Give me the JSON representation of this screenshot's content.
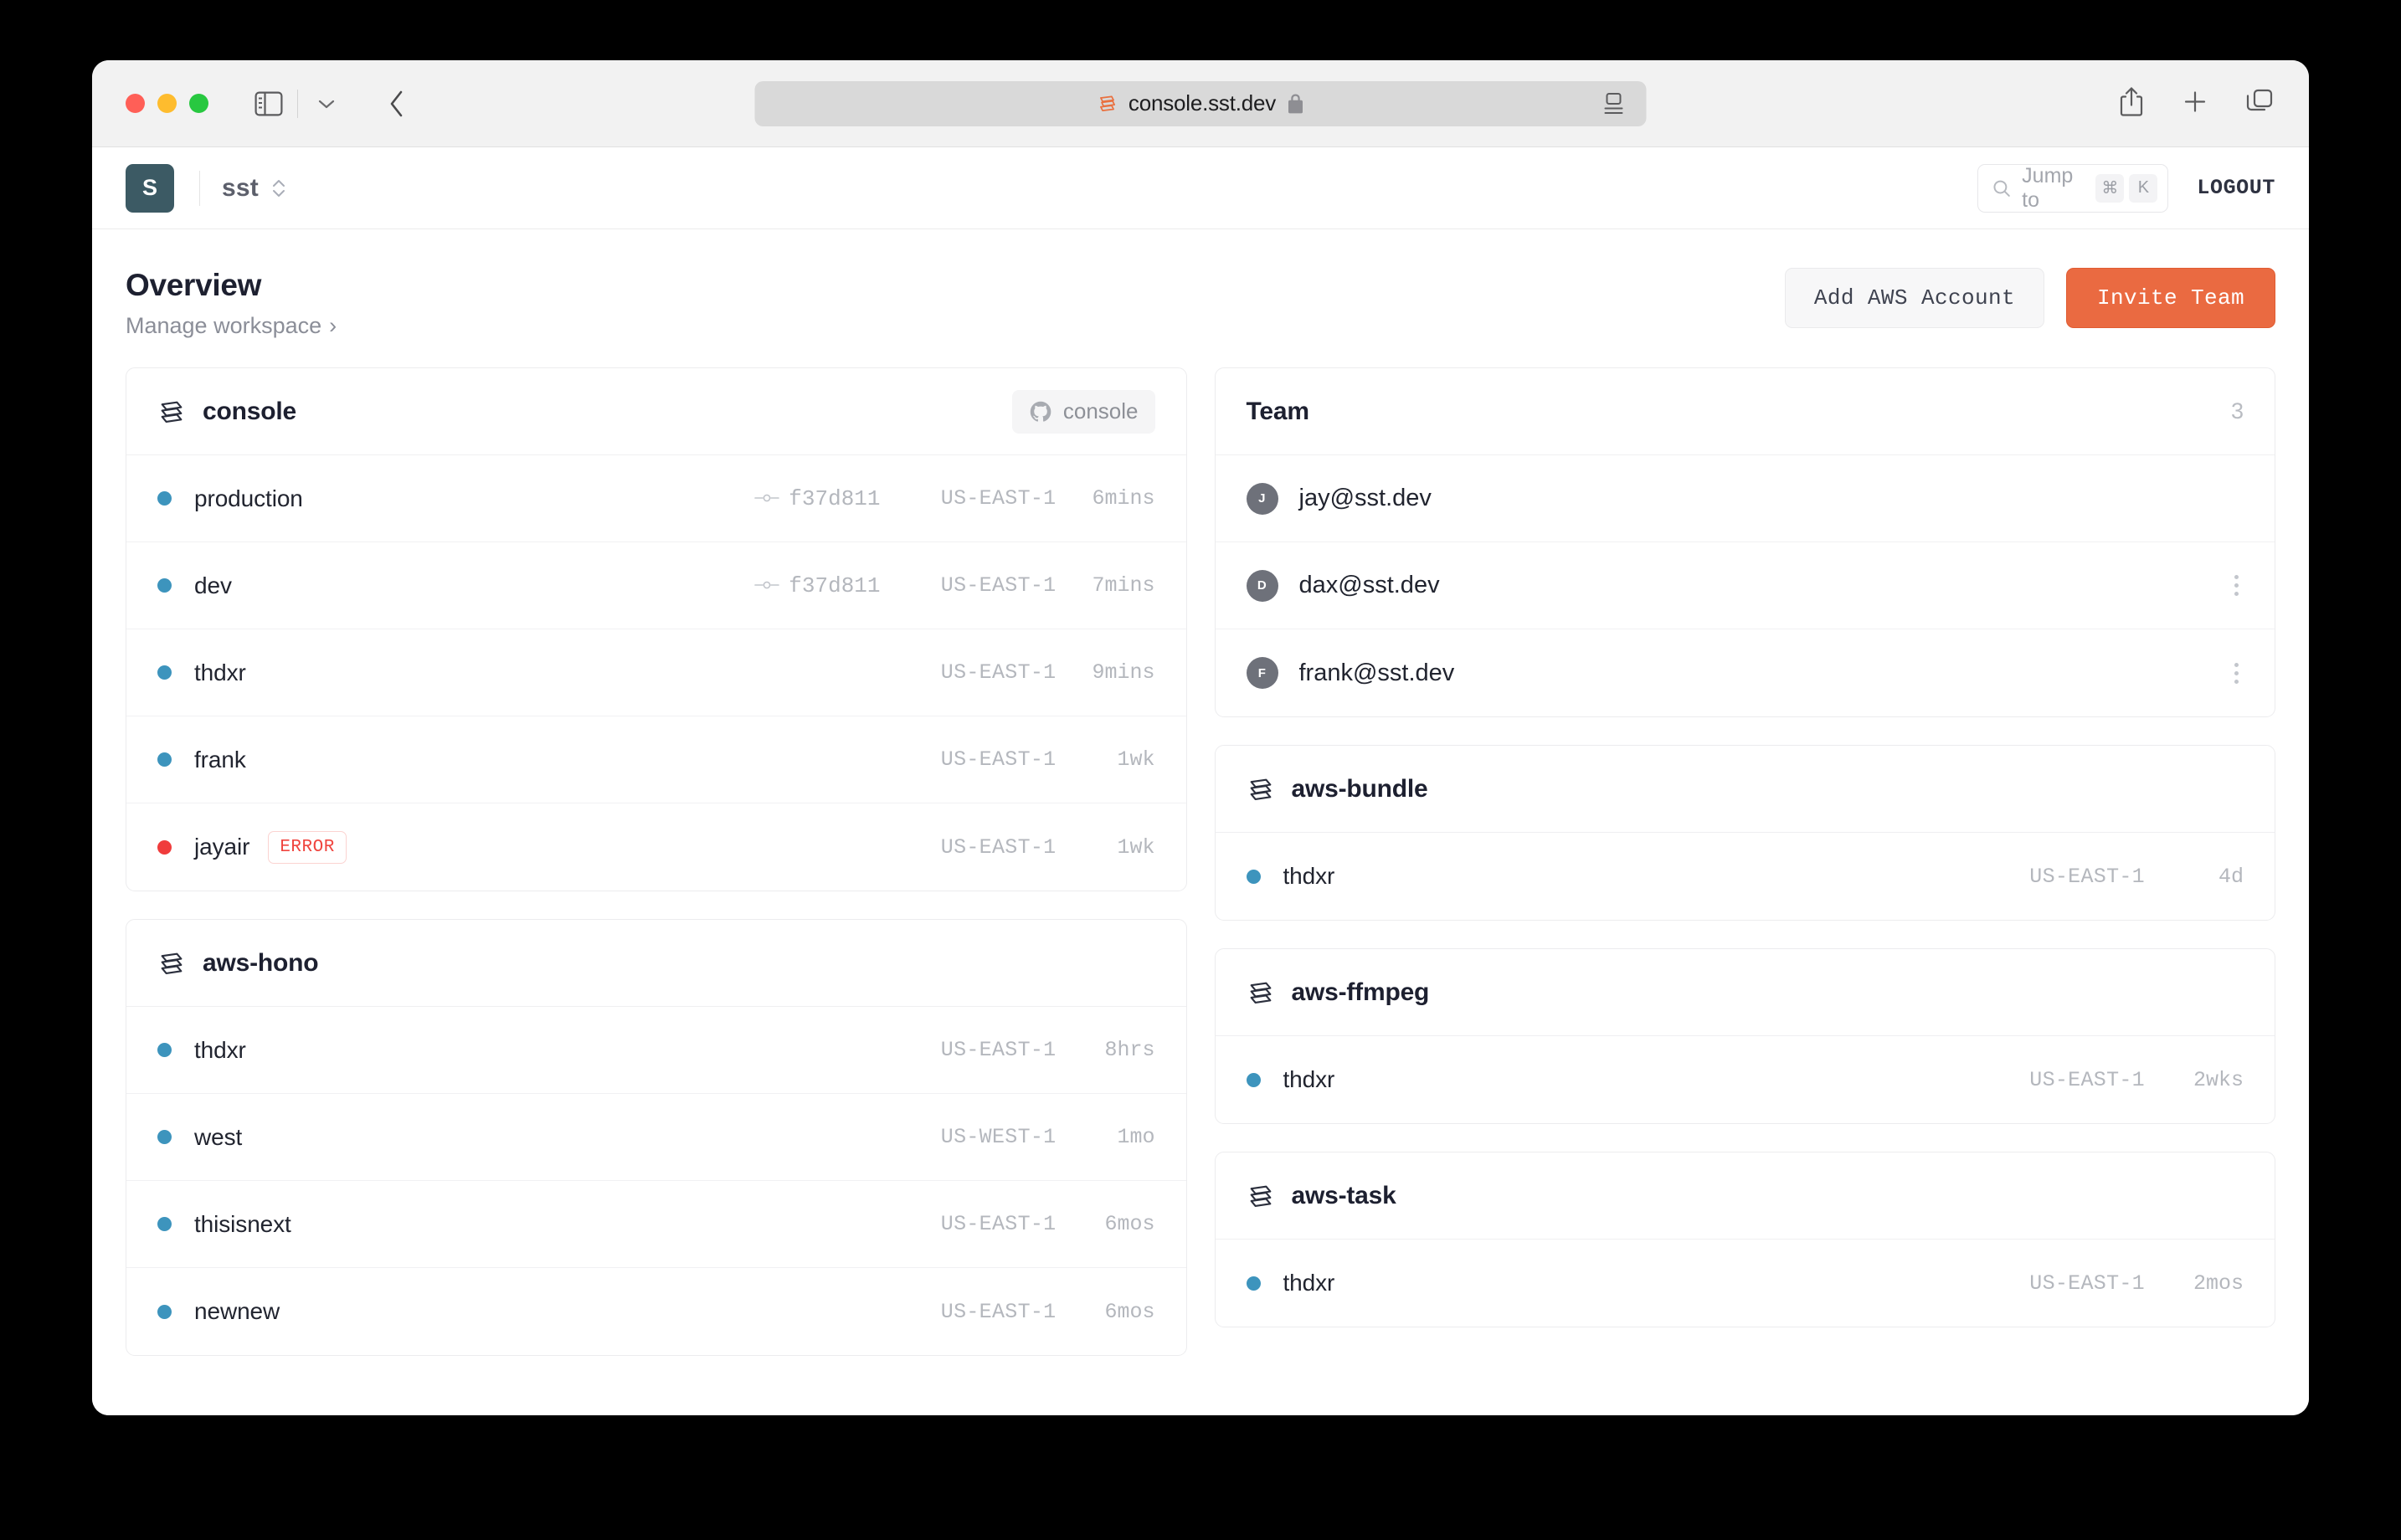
{
  "browser": {
    "url": "console.sst.dev",
    "icons": {
      "sidebar": "sidebar-icon",
      "tab_dropdown": "chevron-down-icon",
      "back": "back-chevron-icon",
      "lock": "lock-icon",
      "reader": "reader-view-icon",
      "share": "share-icon",
      "new_tab": "plus-icon",
      "tabs": "tab-overview-icon"
    }
  },
  "app_header": {
    "avatar_initial": "S",
    "workspace": "sst",
    "search": {
      "placeholder": "Jump to",
      "keys": [
        "⌘",
        "K"
      ]
    },
    "logout": "LOGOUT"
  },
  "page": {
    "title": "Overview",
    "subtitle": "Manage workspace",
    "subtitle_chevron": "›",
    "actions": {
      "secondary": "Add AWS Account",
      "primary": "Invite Team"
    },
    "accent_color": "#ea6a41"
  },
  "left_column": [
    {
      "name": "console",
      "repo_badge": "console",
      "stages": [
        {
          "name": "production",
          "status": "ok",
          "commit": "f37d811",
          "region": "US-EAST-1",
          "time": "6mins"
        },
        {
          "name": "dev",
          "status": "ok",
          "commit": "f37d811",
          "region": "US-EAST-1",
          "time": "7mins"
        },
        {
          "name": "thdxr",
          "status": "ok",
          "commit": "",
          "region": "US-EAST-1",
          "time": "9mins"
        },
        {
          "name": "frank",
          "status": "ok",
          "commit": "",
          "region": "US-EAST-1",
          "time": "1wk"
        },
        {
          "name": "jayair",
          "status": "error",
          "badge": "ERROR",
          "commit": "",
          "region": "US-EAST-1",
          "time": "1wk"
        }
      ]
    },
    {
      "name": "aws-hono",
      "repo_badge": "",
      "stages": [
        {
          "name": "thdxr",
          "status": "ok",
          "commit": "",
          "region": "US-EAST-1",
          "time": "8hrs"
        },
        {
          "name": "west",
          "status": "ok",
          "commit": "",
          "region": "US-WEST-1",
          "time": "1mo"
        },
        {
          "name": "thisisnext",
          "status": "ok",
          "commit": "",
          "region": "US-EAST-1",
          "time": "6mos"
        },
        {
          "name": "newnew",
          "status": "ok",
          "commit": "",
          "region": "US-EAST-1",
          "time": "6mos"
        }
      ]
    }
  ],
  "team": {
    "title": "Team",
    "count": "3",
    "members": [
      {
        "initial": "J",
        "email": "jay@sst.dev",
        "menu": false
      },
      {
        "initial": "D",
        "email": "dax@sst.dev",
        "menu": true
      },
      {
        "initial": "F",
        "email": "frank@sst.dev",
        "menu": true
      }
    ]
  },
  "right_column": [
    {
      "name": "aws-bundle",
      "stages": [
        {
          "name": "thdxr",
          "status": "ok",
          "region": "US-EAST-1",
          "time": "4d"
        }
      ]
    },
    {
      "name": "aws-ffmpeg",
      "stages": [
        {
          "name": "thdxr",
          "status": "ok",
          "region": "US-EAST-1",
          "time": "2wks"
        }
      ]
    },
    {
      "name": "aws-task",
      "stages": [
        {
          "name": "thdxr",
          "status": "ok",
          "region": "US-EAST-1",
          "time": "2mos"
        }
      ]
    }
  ],
  "colors": {
    "dot_ok": "#3d94bd",
    "dot_error": "#f03c3c",
    "avatar_bg": "#3c5a64"
  }
}
